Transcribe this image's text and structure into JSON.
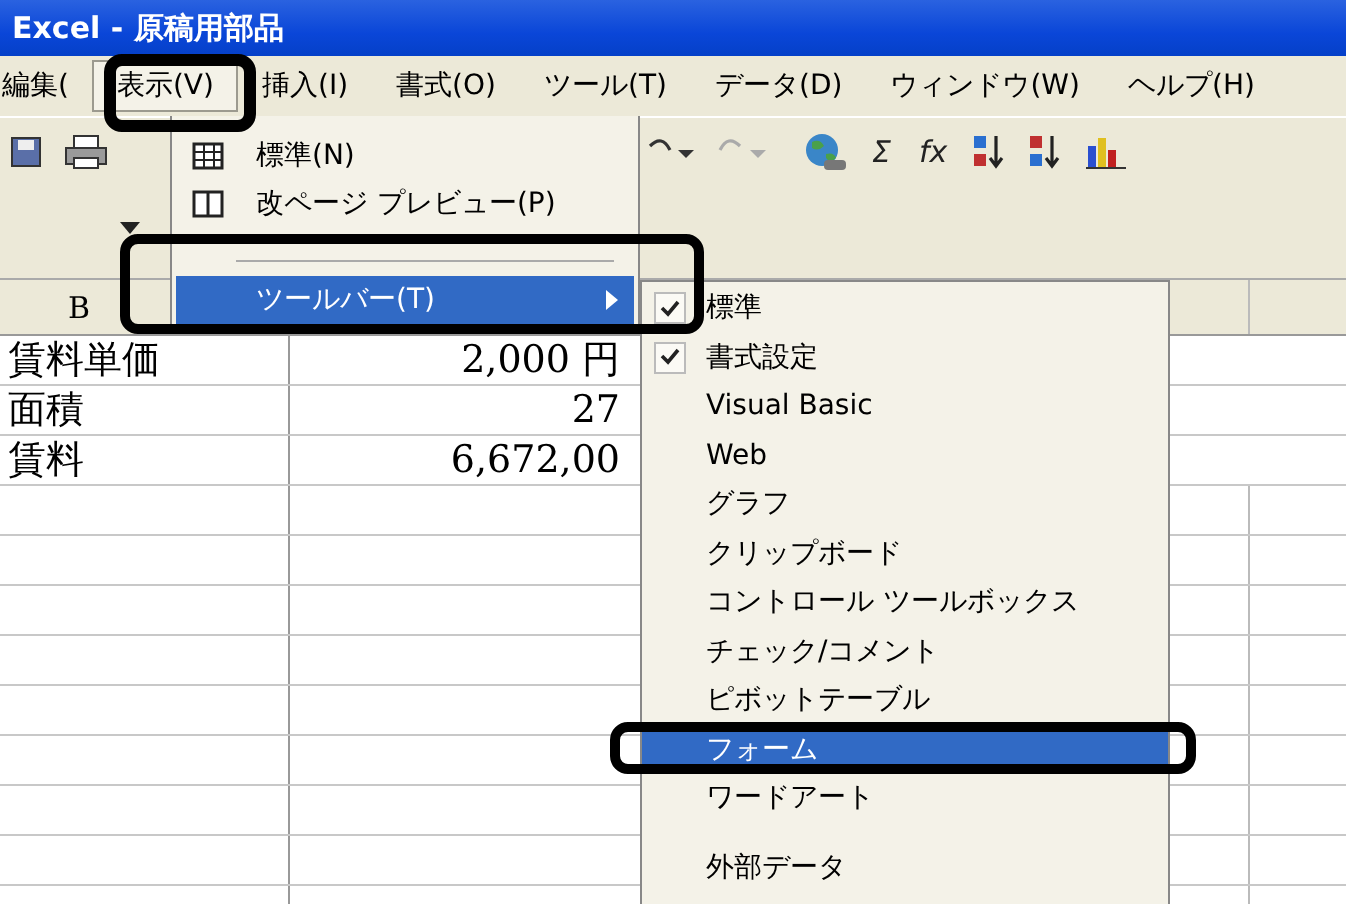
{
  "window": {
    "title": "Excel - 原稿用部品"
  },
  "menu_bar": [
    {
      "label": "編集(",
      "selected": false
    },
    {
      "label": "表示(V)",
      "selected": true
    },
    {
      "label": "挿入(I)",
      "selected": false
    },
    {
      "label": "書式(O)",
      "selected": false
    },
    {
      "label": "ツール(T)",
      "selected": false
    },
    {
      "label": "データ(D)",
      "selected": false
    },
    {
      "label": "ウィンドウ(W)",
      "selected": false
    },
    {
      "label": "ヘルプ(H)",
      "selected": false
    }
  ],
  "toolbar": [
    {
      "kind": "save"
    },
    {
      "kind": "print"
    },
    {
      "kind": "undo"
    },
    {
      "kind": "redo"
    },
    {
      "kind": "globe"
    },
    {
      "kind": "text",
      "label": "Σ"
    },
    {
      "kind": "text",
      "label": "fx"
    },
    {
      "kind": "sort-up"
    },
    {
      "kind": "sort-down"
    },
    {
      "kind": "chart"
    }
  ],
  "view_menu": {
    "items": [
      {
        "kind": "item",
        "label": "標準(N)",
        "selected": false
      },
      {
        "kind": "item",
        "label": "改ページ プレビュー(P)",
        "selected": false
      },
      {
        "kind": "separator"
      },
      {
        "kind": "item",
        "label": "ツールバー(T)",
        "selected": true,
        "submenu": true
      }
    ]
  },
  "sheet": {
    "column_header": "B",
    "rows": [
      [
        "賃料単価",
        "2,000 円"
      ],
      [
        "面積",
        "27"
      ],
      [
        "賃料",
        "6,672,00"
      ]
    ]
  },
  "toolbars_submenu": {
    "items": [
      {
        "kind": "item",
        "label": "標準",
        "checked": true,
        "selected": false
      },
      {
        "kind": "item",
        "label": "書式設定",
        "checked": true,
        "selected": false
      },
      {
        "kind": "item",
        "label": "Visual Basic",
        "checked": false,
        "selected": false
      },
      {
        "kind": "item",
        "label": "Web",
        "checked": false,
        "selected": false
      },
      {
        "kind": "item",
        "label": "グラフ",
        "checked": false,
        "selected": false
      },
      {
        "kind": "item",
        "label": "クリップボード",
        "checked": false,
        "selected": false
      },
      {
        "kind": "item",
        "label": "コントロール ツールボックス",
        "checked": false,
        "selected": false
      },
      {
        "kind": "item",
        "label": "チェック/コメント",
        "checked": false,
        "selected": false
      },
      {
        "kind": "item",
        "label": "ピボットテーブル",
        "checked": false,
        "selected": false
      },
      {
        "kind": "item",
        "label": "フォーム",
        "checked": false,
        "selected": true
      },
      {
        "kind": "item",
        "label": "ワードアート",
        "checked": false,
        "selected": false
      },
      {
        "kind": "separator"
      },
      {
        "kind": "item",
        "label": "外部データ",
        "checked": false,
        "selected": false
      }
    ]
  }
}
